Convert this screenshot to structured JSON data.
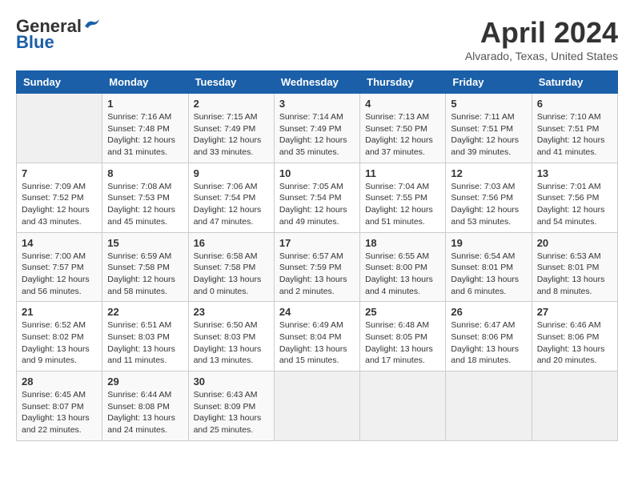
{
  "header": {
    "logo_line1": "General",
    "logo_line2": "Blue",
    "month": "April 2024",
    "location": "Alvarado, Texas, United States"
  },
  "weekdays": [
    "Sunday",
    "Monday",
    "Tuesday",
    "Wednesday",
    "Thursday",
    "Friday",
    "Saturday"
  ],
  "weeks": [
    [
      {
        "day": "",
        "info": ""
      },
      {
        "day": "1",
        "info": "Sunrise: 7:16 AM\nSunset: 7:48 PM\nDaylight: 12 hours\nand 31 minutes."
      },
      {
        "day": "2",
        "info": "Sunrise: 7:15 AM\nSunset: 7:49 PM\nDaylight: 12 hours\nand 33 minutes."
      },
      {
        "day": "3",
        "info": "Sunrise: 7:14 AM\nSunset: 7:49 PM\nDaylight: 12 hours\nand 35 minutes."
      },
      {
        "day": "4",
        "info": "Sunrise: 7:13 AM\nSunset: 7:50 PM\nDaylight: 12 hours\nand 37 minutes."
      },
      {
        "day": "5",
        "info": "Sunrise: 7:11 AM\nSunset: 7:51 PM\nDaylight: 12 hours\nand 39 minutes."
      },
      {
        "day": "6",
        "info": "Sunrise: 7:10 AM\nSunset: 7:51 PM\nDaylight: 12 hours\nand 41 minutes."
      }
    ],
    [
      {
        "day": "7",
        "info": "Sunrise: 7:09 AM\nSunset: 7:52 PM\nDaylight: 12 hours\nand 43 minutes."
      },
      {
        "day": "8",
        "info": "Sunrise: 7:08 AM\nSunset: 7:53 PM\nDaylight: 12 hours\nand 45 minutes."
      },
      {
        "day": "9",
        "info": "Sunrise: 7:06 AM\nSunset: 7:54 PM\nDaylight: 12 hours\nand 47 minutes."
      },
      {
        "day": "10",
        "info": "Sunrise: 7:05 AM\nSunset: 7:54 PM\nDaylight: 12 hours\nand 49 minutes."
      },
      {
        "day": "11",
        "info": "Sunrise: 7:04 AM\nSunset: 7:55 PM\nDaylight: 12 hours\nand 51 minutes."
      },
      {
        "day": "12",
        "info": "Sunrise: 7:03 AM\nSunset: 7:56 PM\nDaylight: 12 hours\nand 53 minutes."
      },
      {
        "day": "13",
        "info": "Sunrise: 7:01 AM\nSunset: 7:56 PM\nDaylight: 12 hours\nand 54 minutes."
      }
    ],
    [
      {
        "day": "14",
        "info": "Sunrise: 7:00 AM\nSunset: 7:57 PM\nDaylight: 12 hours\nand 56 minutes."
      },
      {
        "day": "15",
        "info": "Sunrise: 6:59 AM\nSunset: 7:58 PM\nDaylight: 12 hours\nand 58 minutes."
      },
      {
        "day": "16",
        "info": "Sunrise: 6:58 AM\nSunset: 7:58 PM\nDaylight: 13 hours\nand 0 minutes."
      },
      {
        "day": "17",
        "info": "Sunrise: 6:57 AM\nSunset: 7:59 PM\nDaylight: 13 hours\nand 2 minutes."
      },
      {
        "day": "18",
        "info": "Sunrise: 6:55 AM\nSunset: 8:00 PM\nDaylight: 13 hours\nand 4 minutes."
      },
      {
        "day": "19",
        "info": "Sunrise: 6:54 AM\nSunset: 8:01 PM\nDaylight: 13 hours\nand 6 minutes."
      },
      {
        "day": "20",
        "info": "Sunrise: 6:53 AM\nSunset: 8:01 PM\nDaylight: 13 hours\nand 8 minutes."
      }
    ],
    [
      {
        "day": "21",
        "info": "Sunrise: 6:52 AM\nSunset: 8:02 PM\nDaylight: 13 hours\nand 9 minutes."
      },
      {
        "day": "22",
        "info": "Sunrise: 6:51 AM\nSunset: 8:03 PM\nDaylight: 13 hours\nand 11 minutes."
      },
      {
        "day": "23",
        "info": "Sunrise: 6:50 AM\nSunset: 8:03 PM\nDaylight: 13 hours\nand 13 minutes."
      },
      {
        "day": "24",
        "info": "Sunrise: 6:49 AM\nSunset: 8:04 PM\nDaylight: 13 hours\nand 15 minutes."
      },
      {
        "day": "25",
        "info": "Sunrise: 6:48 AM\nSunset: 8:05 PM\nDaylight: 13 hours\nand 17 minutes."
      },
      {
        "day": "26",
        "info": "Sunrise: 6:47 AM\nSunset: 8:06 PM\nDaylight: 13 hours\nand 18 minutes."
      },
      {
        "day": "27",
        "info": "Sunrise: 6:46 AM\nSunset: 8:06 PM\nDaylight: 13 hours\nand 20 minutes."
      }
    ],
    [
      {
        "day": "28",
        "info": "Sunrise: 6:45 AM\nSunset: 8:07 PM\nDaylight: 13 hours\nand 22 minutes."
      },
      {
        "day": "29",
        "info": "Sunrise: 6:44 AM\nSunset: 8:08 PM\nDaylight: 13 hours\nand 24 minutes."
      },
      {
        "day": "30",
        "info": "Sunrise: 6:43 AM\nSunset: 8:09 PM\nDaylight: 13 hours\nand 25 minutes."
      },
      {
        "day": "",
        "info": ""
      },
      {
        "day": "",
        "info": ""
      },
      {
        "day": "",
        "info": ""
      },
      {
        "day": "",
        "info": ""
      }
    ]
  ]
}
